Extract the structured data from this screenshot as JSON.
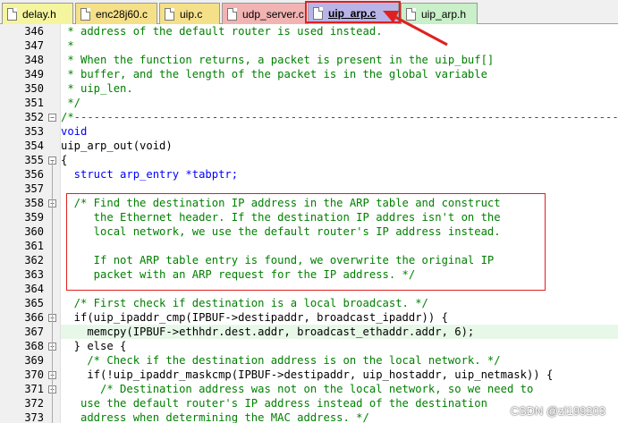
{
  "tabs": [
    {
      "label": "delay.h",
      "color": "#f5f5a0",
      "active": false
    },
    {
      "label": "enc28j60.c",
      "color": "#f5e08a",
      "active": false
    },
    {
      "label": "uip.c",
      "color": "#f5e08a",
      "active": false
    },
    {
      "label": "udp_server.c",
      "color": "#f2b3b3",
      "active": false
    },
    {
      "label": "uip_arp.c",
      "color": "#b9b4e8",
      "active": true
    },
    {
      "label": "uip_arp.h",
      "color": "#c9f0c9",
      "active": false
    }
  ],
  "lines": [
    {
      "num": "346",
      "text": " * address of the default router is used instead."
    },
    {
      "num": "347",
      "text": " *"
    },
    {
      "num": "348",
      "text": " * When the function returns, a packet is present in the uip_buf[]"
    },
    {
      "num": "349",
      "text": " * buffer, and the length of the packet is in the global variable"
    },
    {
      "num": "350",
      "text": " * uip_len."
    },
    {
      "num": "351",
      "text": " */"
    },
    {
      "num": "352",
      "text": "/*-----------------------------------------------------------------------------------"
    },
    {
      "num": "353",
      "text": "void"
    },
    {
      "num": "354",
      "text": "uip_arp_out(void)"
    },
    {
      "num": "355",
      "text": "{"
    },
    {
      "num": "356",
      "text": "  struct arp_entry *tabptr;"
    },
    {
      "num": "357",
      "text": ""
    },
    {
      "num": "358",
      "text": "  /* Find the destination IP address in the ARP table and construct"
    },
    {
      "num": "359",
      "text": "     the Ethernet header. If the destination IP addres isn't on the"
    },
    {
      "num": "360",
      "text": "     local network, we use the default router's IP address instead."
    },
    {
      "num": "361",
      "text": ""
    },
    {
      "num": "362",
      "text": "     If not ARP table entry is found, we overwrite the original IP"
    },
    {
      "num": "363",
      "text": "     packet with an ARP request for the IP address. */"
    },
    {
      "num": "364",
      "text": ""
    },
    {
      "num": "365",
      "text": "  /* First check if destination is a local broadcast. */"
    },
    {
      "num": "366",
      "text": "  if(uip_ipaddr_cmp(IPBUF->destipaddr, broadcast_ipaddr)) {"
    },
    {
      "num": "367",
      "text": "    memcpy(IPBUF->ethhdr.dest.addr, broadcast_ethaddr.addr, 6);"
    },
    {
      "num": "368",
      "text": "  } else {"
    },
    {
      "num": "369",
      "text": "    /* Check if the destination address is on the local network. */"
    },
    {
      "num": "370",
      "text": "    if(!uip_ipaddr_maskcmp(IPBUF->destipaddr, uip_hostaddr, uip_netmask)) {"
    },
    {
      "num": "371",
      "text": "      /* Destination address was not on the local network, so we need to"
    },
    {
      "num": "372",
      "text": "   use the default router's IP address instead of the destination"
    },
    {
      "num": "373",
      "text": "   address when determining the MAC address. */"
    }
  ],
  "watermark": "CSDN @zl199203"
}
